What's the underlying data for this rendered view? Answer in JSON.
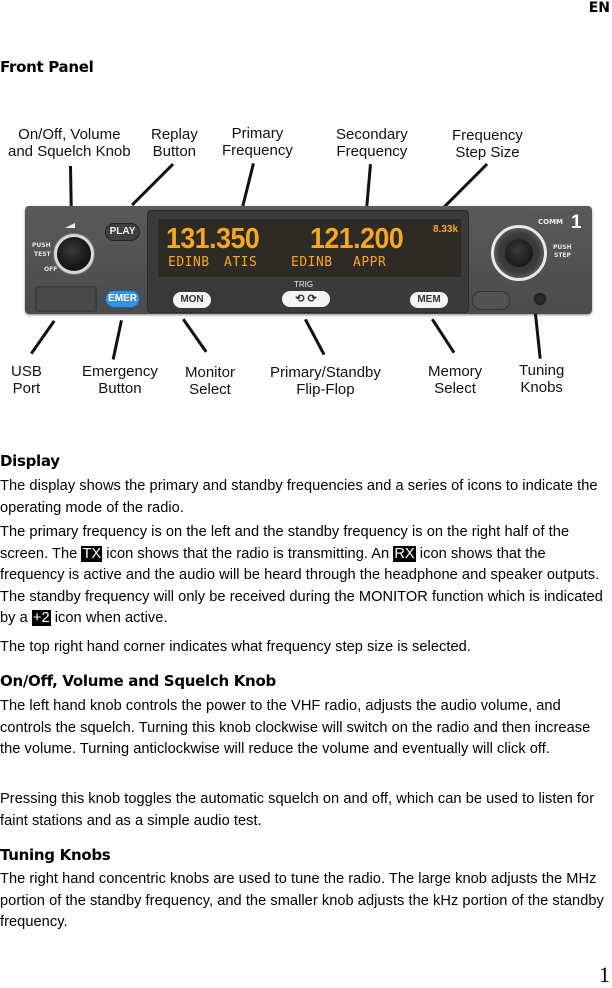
{
  "header": {
    "language": "EN"
  },
  "page_title": "Front Panel",
  "figure": {
    "callouts_top": [
      "On/Off, Volume\nand Squelch Knob",
      "Replay\nButton",
      "Primary\nFrequency",
      "Secondary\nFrequency",
      "Frequency\nStep Size"
    ],
    "callouts_bottom": [
      "USB\nPort",
      "Emergency\nButton",
      "Monitor\nSelect",
      "Primary/Standby\nFlip-Flop",
      "Memory\nSelect",
      "Tuning\nKnobs"
    ],
    "radio": {
      "primary_frequency": "131.350",
      "primary_label_1": "EDINB",
      "primary_label_2": "ATIS",
      "standby_frequency": "121.200",
      "standby_label_1": "EDINB",
      "standby_label_2": "APPR",
      "step_size": "8.33k",
      "brand": "TRIG",
      "buttons": {
        "play": "PLAY",
        "emer": "EMER",
        "mon": "MON",
        "flip_flop_glyph": "⟲ ⟳",
        "mem": "MEM"
      },
      "left_knob_labels": {
        "push": "PUSH",
        "test": "TEST",
        "off": "OFF"
      },
      "right_knob_labels": {
        "push": "PUSH",
        "step": "STEP"
      },
      "comm_label": "COMM",
      "comm_number": "1"
    }
  },
  "sections": {
    "display": {
      "heading": "Display",
      "p1": "The display shows the primary and standby frequencies and a series of icons to indicate the operating mode of the radio.",
      "p2_a": "The primary frequency is on the left and the standby frequency is on the right half of the screen.  The ",
      "tx_icon": "TX",
      "p2_b": " icon shows that the radio is transmitting.  An ",
      "rx_icon": "RX",
      "p2_c": " icon shows that the frequency is active and the audio will be heard through the headphone and speaker outputs.  The standby frequency will only be received during the MONITOR function which is indicated by a ",
      "mon_icon": "+2",
      "p2_d": " icon when active.",
      "p3": "The top right hand corner indicates what frequency step size is selected."
    },
    "onoff": {
      "heading": "On/Off, Volume and Squelch Knob",
      "p1": "The left hand knob controls the power to the VHF radio, adjusts the audio volume, and controls the squelch.  Turning this knob clockwise will switch on the radio and then increase the volume.  Turning anticlockwise will reduce the volume and eventually will click off.",
      "p2": "Pressing this knob toggles the automatic squelch on and off, which can be used to listen for faint stations and as a simple audio test."
    },
    "tuning": {
      "heading": "Tuning Knobs",
      "p1": "The right hand concentric knobs are used to tune the radio.  The large knob adjusts the MHz portion of the standby frequency, and the smaller knob adjusts the kHz portion of the standby frequency."
    }
  },
  "page_number": "1"
}
